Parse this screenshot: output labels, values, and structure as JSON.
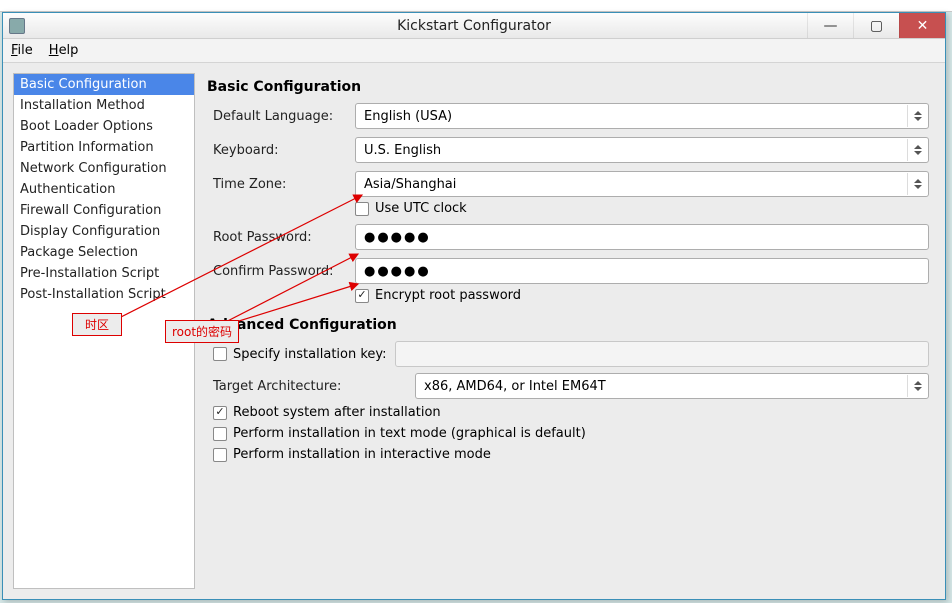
{
  "window": {
    "title": "Kickstart Configurator"
  },
  "menubar": [
    "File",
    "Help"
  ],
  "sidebar": {
    "items": [
      "Basic Configuration",
      "Installation Method",
      "Boot Loader Options",
      "Partition Information",
      "Network Configuration",
      "Authentication",
      "Firewall Configuration",
      "Display Configuration",
      "Package Selection",
      "Pre-Installation Script",
      "Post-Installation Script"
    ],
    "selected_index": 0
  },
  "basic": {
    "title": "Basic Configuration",
    "labels": {
      "default_language": "Default Language:",
      "keyboard": "Keyboard:",
      "time_zone": "Time Zone:",
      "use_utc": "Use UTC clock",
      "root_password": "Root Password:",
      "confirm_password": "Confirm Password:",
      "encrypt_root": "Encrypt root password"
    },
    "values": {
      "default_language": "English (USA)",
      "keyboard": "U.S. English",
      "time_zone": "Asia/Shanghai",
      "use_utc": false,
      "root_password_mask": "●●●●●",
      "confirm_password_mask": "●●●●●",
      "encrypt_root": true
    }
  },
  "advanced": {
    "title": "Advanced Configuration",
    "labels": {
      "specify_key": "Specify installation key:",
      "target_arch": "Target Architecture:",
      "reboot": "Reboot system after installation",
      "text_mode": "Perform installation in text mode (graphical is default)",
      "interactive": "Perform installation in interactive mode"
    },
    "values": {
      "specify_key": false,
      "target_arch": "x86, AMD64, or Intel EM64T",
      "reboot": true,
      "text_mode": false,
      "interactive": false
    }
  },
  "annotations": {
    "tz": "时区",
    "root_pwd": "root的密码"
  }
}
